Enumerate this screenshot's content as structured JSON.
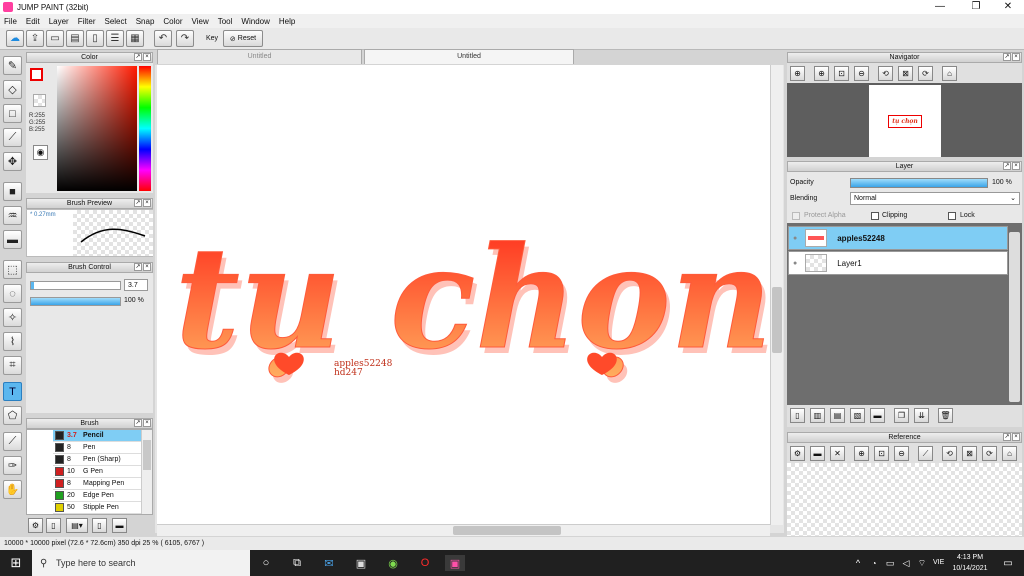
{
  "app": {
    "title": "JUMP PAINT (32bit)"
  },
  "menu": [
    "File",
    "Edit",
    "Layer",
    "Filter",
    "Select",
    "Snap",
    "Color",
    "View",
    "Tool",
    "Window",
    "Help"
  ],
  "toolbar": {
    "key_label": "Key",
    "reset_label": "Reset"
  },
  "tabs": [
    {
      "label": "Untitled",
      "active": false
    },
    {
      "label": "Untitled",
      "active": true
    }
  ],
  "color_panel": {
    "title": "Color",
    "r": "R:255",
    "g": "G:255",
    "b": "B:255"
  },
  "brush_preview": {
    "title": "Brush Preview",
    "size": "* 0.27mm"
  },
  "brush_control": {
    "title": "Brush Control",
    "size": "3.7",
    "opacity": "100 %"
  },
  "brush_panel": {
    "title": "Brush",
    "items": [
      {
        "size": "3.7",
        "name": "Pencil",
        "color": "#222222",
        "selected": true
      },
      {
        "size": "8",
        "name": "Pen",
        "color": "#222222"
      },
      {
        "size": "8",
        "name": "Pen (Sharp)",
        "color": "#222222"
      },
      {
        "size": "10",
        "name": "G Pen",
        "color": "#d02020"
      },
      {
        "size": "8",
        "name": "Mapping Pen",
        "color": "#d02020"
      },
      {
        "size": "20",
        "name": "Edge Pen",
        "color": "#20a020"
      },
      {
        "size": "50",
        "name": "Stipple Pen",
        "color": "#e0d000"
      }
    ]
  },
  "navigator": {
    "title": "Navigator",
    "thumb_text": "tụ chọn"
  },
  "layer_panel": {
    "title": "Layer",
    "opacity_label": "Opacity",
    "opacity_value": "100 %",
    "opacity_fraction": 1.0,
    "blending_label": "Blending",
    "blending_value": "Normal",
    "protect_alpha": "Protect Alpha",
    "clipping": "Clipping",
    "lock": "Lock",
    "layers": [
      {
        "name": "apples52248",
        "selected": true
      },
      {
        "name": "Layer1",
        "selected": false
      }
    ]
  },
  "reference": {
    "title": "Reference"
  },
  "artwork": {
    "main_text": "tụ chọn",
    "signature_1": "apples52248",
    "signature_2": "hd247"
  },
  "status": {
    "text": "10000 * 10000 pixel  (72.6 * 72.6cm)  350 dpi  25 %  ( 6105, 6767 )"
  },
  "taskbar": {
    "search_placeholder": "Type here to search",
    "lang": "VIE",
    "time": "4:13 PM",
    "date": "10/14/2021"
  },
  "colors": {
    "accent": "#5bb7ef",
    "layer_selected": "#7fcdf4",
    "art_top": "#ff2a1a",
    "art_bottom": "#ffb060"
  }
}
